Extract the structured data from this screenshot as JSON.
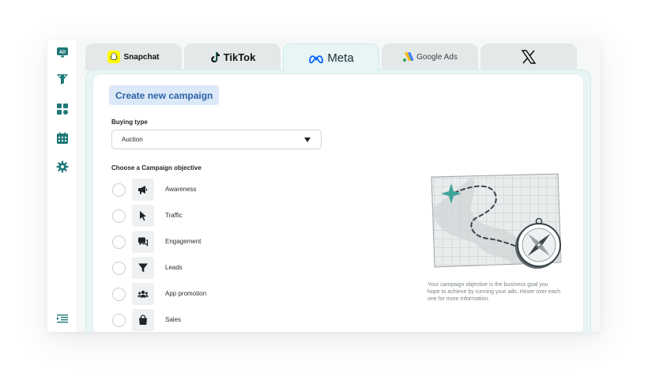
{
  "sidebar": {
    "items": [
      {
        "name": "ad-icon",
        "label": "AD"
      },
      {
        "name": "funnel-icon"
      },
      {
        "name": "apps-icon"
      },
      {
        "name": "calendar-icon"
      },
      {
        "name": "gear-icon"
      }
    ],
    "bottom": {
      "name": "collapse-menu-icon"
    }
  },
  "tabs": [
    {
      "label": "Snapchat",
      "active": false
    },
    {
      "label": "TikTok",
      "active": false
    },
    {
      "label": "Meta",
      "active": true
    },
    {
      "label": "Google Ads",
      "active": false
    },
    {
      "label": "X",
      "active": false
    }
  ],
  "form": {
    "create_button": "Create new campaign",
    "buying_type_label": "Buying type",
    "buying_type_value": "Auction",
    "objective_label": "Choose a Campaign objective",
    "objectives": [
      {
        "label": "Awareness",
        "icon": "megaphone-icon"
      },
      {
        "label": "Traffic",
        "icon": "cursor-icon"
      },
      {
        "label": "Engagement",
        "icon": "chat-icon"
      },
      {
        "label": "Leads",
        "icon": "funnel-icon"
      },
      {
        "label": "App promotion",
        "icon": "people-icon"
      },
      {
        "label": "Sales",
        "icon": "shopping-bag-icon"
      }
    ],
    "help_text": "Your campaign objective is the business goal you hope to achieve by running your ads. Hover over each one for more information."
  },
  "colors": {
    "accent": "#2d62a8",
    "accent_bg": "#dbe8f7",
    "sidebar_icon": "#1f7a78",
    "panel_tint": "#e7f6f5"
  }
}
